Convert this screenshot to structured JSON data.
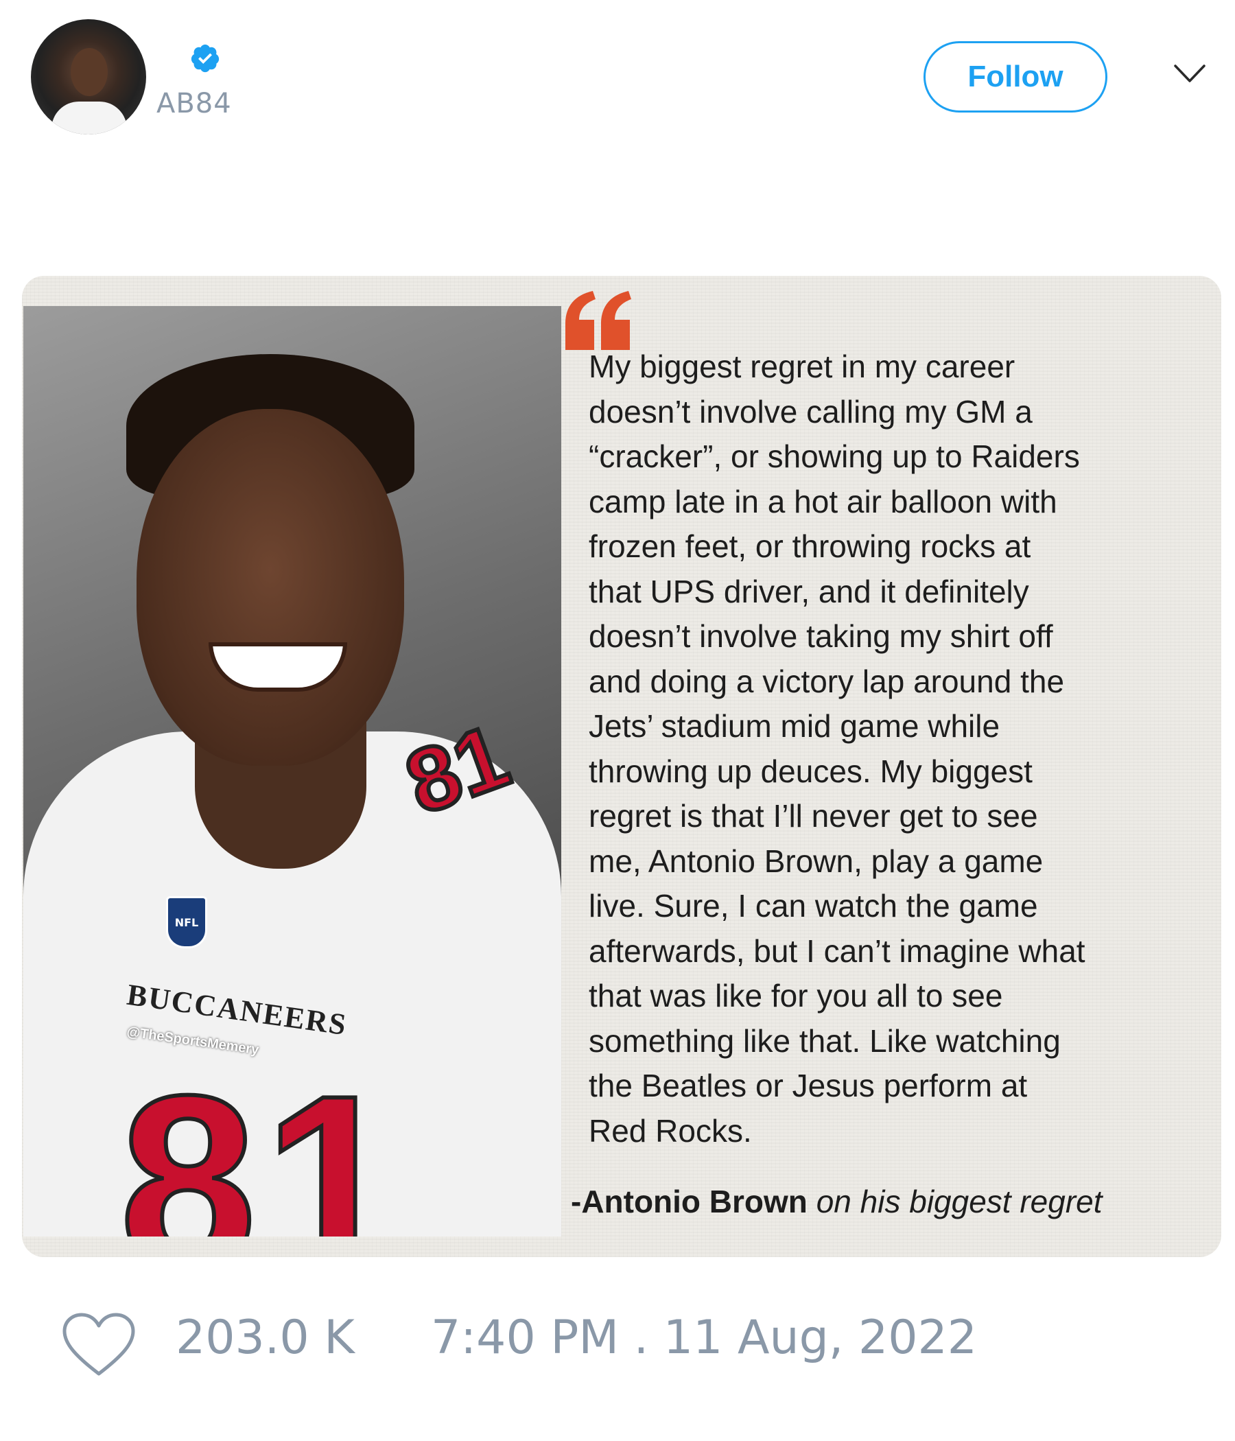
{
  "user": {
    "handle": "AB84",
    "verified": true,
    "avatar_icon": "profile-photo"
  },
  "actions": {
    "follow_label": "Follow",
    "menu_icon": "chevron-down-icon"
  },
  "media": {
    "quote_lines": [
      "My biggest regret in my career",
      "doesn’t involve calling my GM a",
      "“cracker”, or showing up to Raiders",
      "camp late in a hot air balloon with",
      "frozen feet, or throwing rocks at",
      "that UPS driver, and it definitely",
      "doesn’t involve taking my shirt off",
      "and doing a victory lap around the",
      "Jets’ stadium mid game while",
      "throwing up deuces. My biggest",
      "regret is that I’ll never get to see",
      "me, Antonio Brown, play a game",
      "live. Sure, I can watch the game",
      "afterwards, but I can’t imagine what",
      "that was like for you all to see",
      "something like that. Like watching",
      "the Beatles or Jesus perform at",
      "Red Rocks."
    ],
    "attribution_name": "-Antonio Brown",
    "attribution_context": "on his biggest regret",
    "photo": {
      "jersey_number": "81",
      "shoulder_number": "81",
      "team_text": "BUCCANEERS",
      "watermark": "@TheSportsMemery",
      "league_logo": "NFL"
    },
    "accent_color": "#e0512b"
  },
  "footer": {
    "like_count": "203.0 K",
    "timestamp": "7:40 PM . 11 Aug, 2022"
  },
  "colors": {
    "brand_blue": "#1da1f2",
    "muted_gray": "#8a98a8"
  }
}
